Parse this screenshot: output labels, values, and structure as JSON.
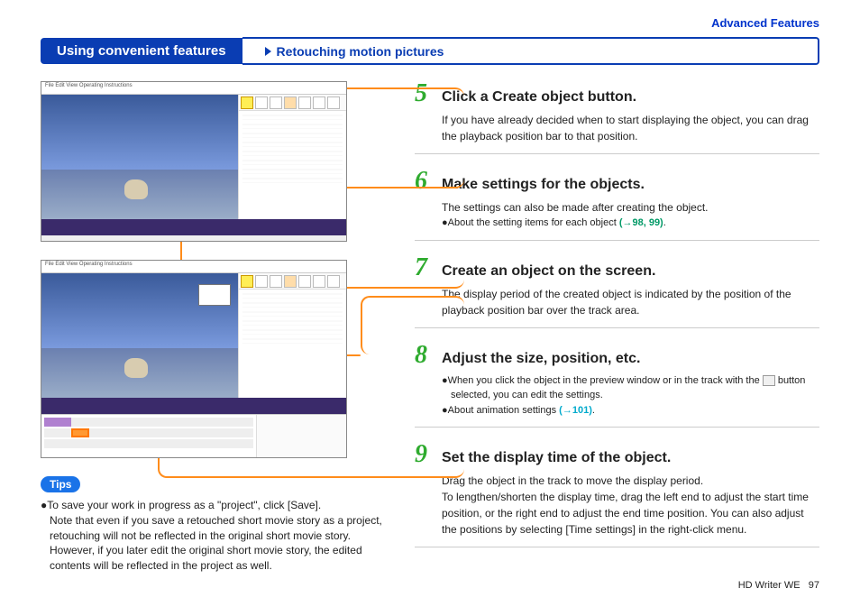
{
  "breadcrumb": "Advanced Features",
  "header_left": "Using convenient features",
  "header_right": "Retouching motion pictures",
  "screenshot_menu": "File   Edit   View   Operating Instructions",
  "steps": {
    "s5": {
      "num": "5",
      "title": "Click a Create object button.",
      "body": "If you have already decided when to start displaying the object, you can drag the playback position bar to that position."
    },
    "s6": {
      "num": "6",
      "title": "Make settings for the objects.",
      "body1": "The settings can also be made after creating the object.",
      "bullet1": "●About the setting items for each object ",
      "bullet1_link": "(→98, 99)",
      "bullet1_dot": "."
    },
    "s7": {
      "num": "7",
      "title": "Create an object on the screen.",
      "body": "The display period of the created object is indicated by the position of the playback position bar over the track area."
    },
    "s8": {
      "num": "8",
      "title": "Adjust the size, position, etc.",
      "bullet1": "●When you click the object in the preview window or in the track with the ",
      "bullet1_end": " button selected, you can edit the settings.",
      "bullet2": "●About animation settings ",
      "bullet2_link": "(→101)",
      "bullet2_dot": "."
    },
    "s9": {
      "num": "9",
      "title": "Set the display time of the object.",
      "body": "Drag the object in the track to move the display period.\nTo lengthen/shorten the display time, drag the left end to adjust the start time position, or the right end to adjust the end time position. You can also adjust the positions by selecting [Time settings] in the right-click menu."
    }
  },
  "tips": {
    "label": "Tips",
    "body": "●To save your work in progress as a \"project\", click [Save].\nNote that even if you save a retouched short movie story as a project, retouching will not be reflected in the original short movie story. However, if you later edit the original short movie story, the edited contents will be reflected in the project as well."
  },
  "footer_doc": "HD Writer WE",
  "footer_page": "97"
}
